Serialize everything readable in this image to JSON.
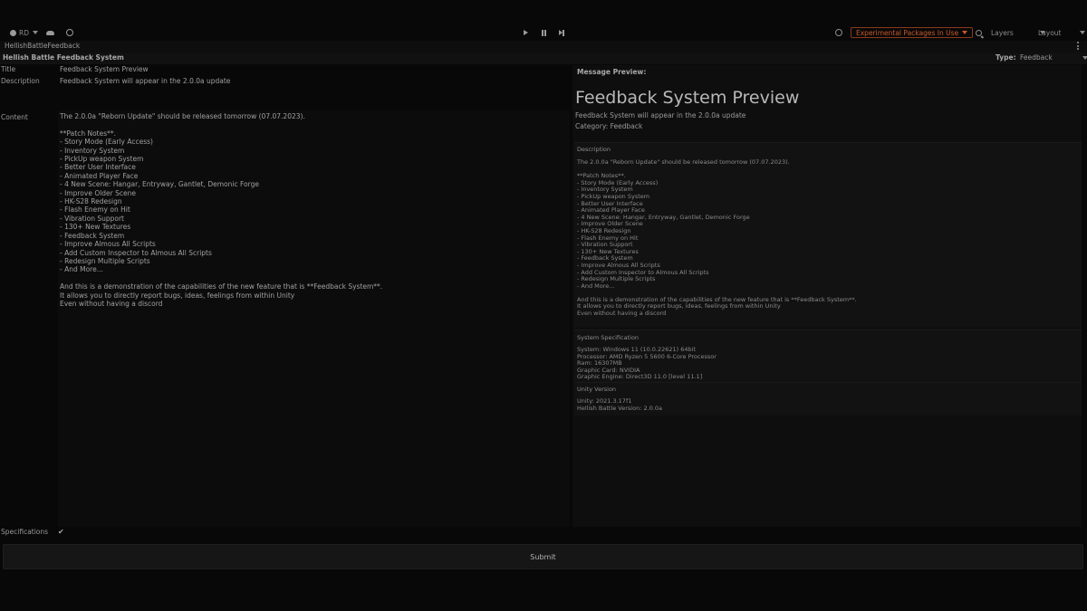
{
  "toolbar": {
    "account": "RD",
    "experimental_packages": "Experimental Packages In Use",
    "layers": "Layers",
    "layout": "Layout"
  },
  "tab": {
    "title": "HellishBattleFeedback"
  },
  "window": {
    "title": "Hellish Battle Feedback System",
    "type_label": "Type:",
    "type_value": "Feedback"
  },
  "editor": {
    "title_label": "Title",
    "title_value": "Feedback System Preview",
    "description_label": "Description",
    "description_value": "Feedback System will appear in the 2.0.0a update",
    "content_label": "Content",
    "content_value": "The 2.0.0a \"Reborn Update\" should be released tomorrow (07.07.2023).\n\n**Patch Notes**.\n- Story Mode (Early Access)\n- Inventory System\n- PickUp weapon System\n- Better User Interface\n- Animated Player Face\n- 4 New Scene: Hangar, Entryway, Gantlet, Demonic Forge\n- Improve Older Scene\n- HK-S28 Redesign\n- Flash Enemy on Hit\n- Vibration Support\n- 130+ New Textures\n- Feedback System\n- Improve Almous All Scripts\n- Add Custom Inspector to Almous All Scripts\n- Redesign Multiple Scripts\n- And More...\n\nAnd this is a demonstration of the capabilities of the new feature that is **Feedback System**.\nIt allows you to directly report bugs, ideas, feelings from within Unity\nEven without having a discord",
    "specifications_label": "Specifications",
    "specifications_checked": true,
    "check_glyph": "✔"
  },
  "preview": {
    "label": "Message Preview:",
    "title": "Feedback System Preview",
    "description": "Feedback System will appear in the 2.0.0a update",
    "category": "Category: Feedback",
    "description_box": {
      "heading": "Description",
      "text": "The 2.0.0a \"Reborn Update\" should be released tomorrow (07.07.2023).\n\n**Patch Notes**.\n- Story Mode (Early Access)\n- Inventory System\n- PickUp weapon System\n- Better User Interface\n- Animated Player Face\n- 4 New Scene: Hangar, Entryway, Gantlet, Demonic Forge\n- Improve Older Scene\n- HK-S28 Redesign\n- Flash Enemy on Hit\n- Vibration Support\n- 130+ New Textures\n- Feedback System\n- Improve Almous All Scripts\n- Add Custom Inspector to Almous All Scripts\n- Redesign Multiple Scripts\n- And More...\n\nAnd this is a demonstration of the capabilities of the new feature that is **Feedback System**.\nIt allows you to directly report bugs, ideas, feelings from within Unity\nEven without having a discord"
    },
    "system_box": {
      "heading": "System Specification",
      "text": "System: Windows 11  (10.0.22621) 64bit\nProcessor: AMD Ryzen 5 5600 6-Core Processor\nRam: 16307MB\nGraphic Card: NVIDIA\nGraphic Engine: Direct3D 11.0 [level 11.1]"
    },
    "unity_box": {
      "heading": "Unity Version",
      "text": "Unity: 2021.3.17f1\nHellish Battle Version: 2.0.0a"
    }
  },
  "submit_label": "Submit"
}
